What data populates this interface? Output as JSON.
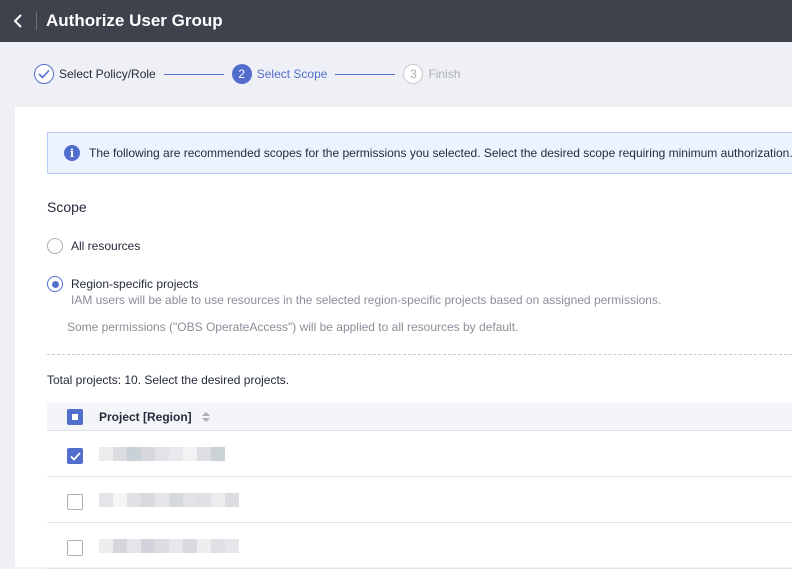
{
  "header": {
    "title": "Authorize User Group",
    "back_icon": "chevron-left-icon"
  },
  "steps": [
    {
      "number": "1",
      "label": "Select Policy/Role",
      "state": "done"
    },
    {
      "number": "2",
      "label": "Select Scope",
      "state": "active"
    },
    {
      "number": "3",
      "label": "Finish",
      "state": "todo"
    }
  ],
  "info": {
    "text": "The following are recommended scopes for the permissions you selected. Select the desired scope requiring minimum authorization."
  },
  "scope": {
    "label": "Scope",
    "options": [
      {
        "title": "All resources",
        "selected": false
      },
      {
        "title": "Region-specific projects",
        "description": "IAM users will be able to use resources in the selected region-specific projects based on assigned permissions.",
        "selected": true
      }
    ],
    "note": "Some permissions (\"OBS OperateAccess\") will be applied to all resources by default."
  },
  "projects": {
    "total_text": "Total projects: 10. Select the desired projects.",
    "column_header": "Project [Region]",
    "header_checkbox": "partial",
    "rows": [
      {
        "checked": true,
        "name_obscured": true
      },
      {
        "checked": false,
        "name_obscured": true
      },
      {
        "checked": false,
        "name_obscured": true
      }
    ]
  },
  "colors": {
    "accent": "#526ecc",
    "topbar": "#3d424d",
    "info_bg": "#edf3fe"
  }
}
